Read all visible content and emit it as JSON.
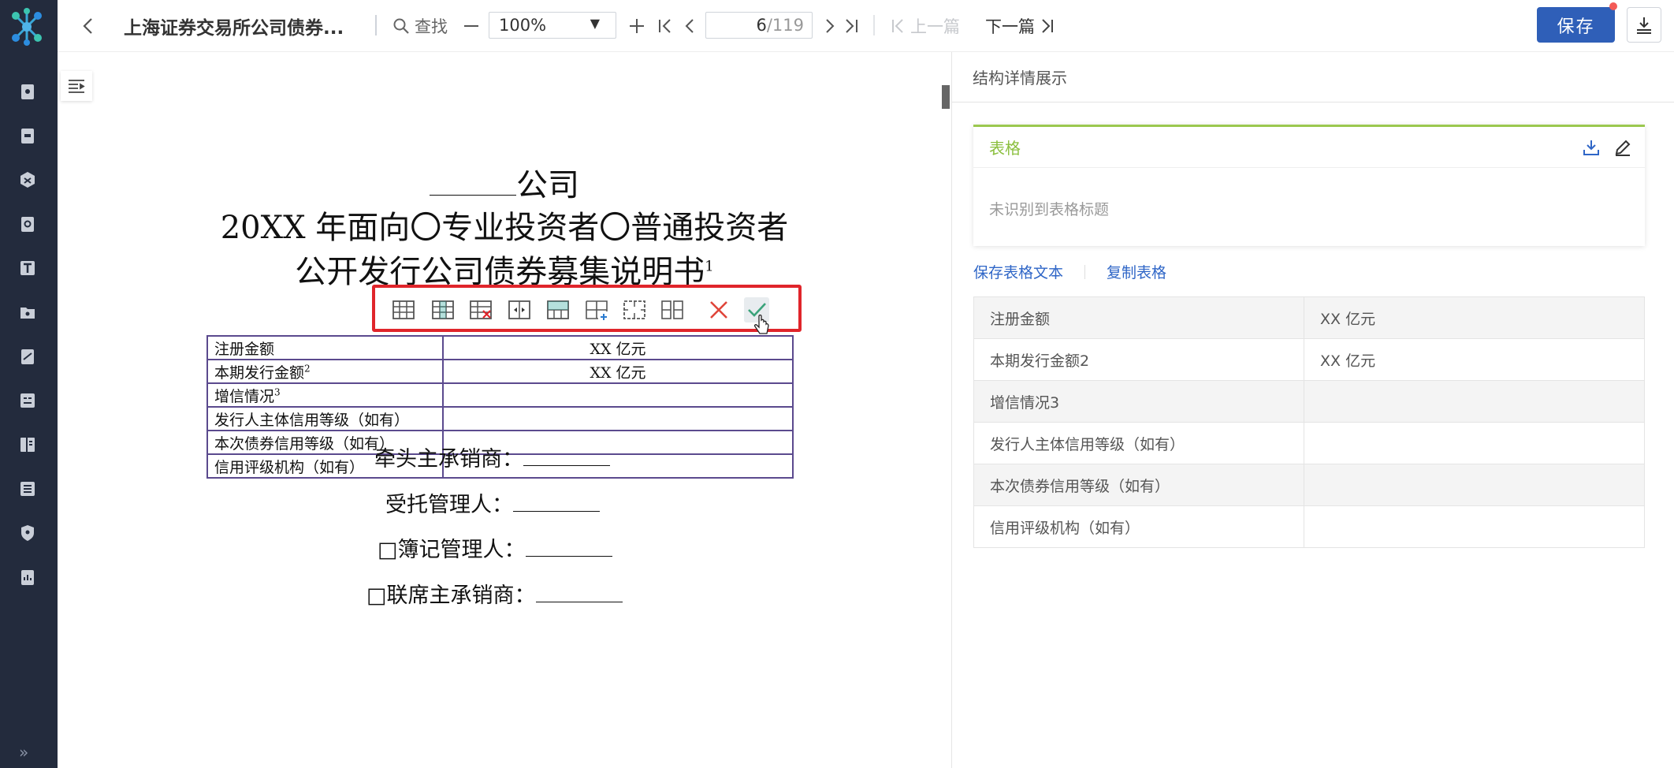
{
  "toolbar": {
    "doc_title": "上海证券交易所公司债券...",
    "find_label": "查找",
    "zoom_value": "100%",
    "page_current": "6",
    "page_total": "/119",
    "prev_doc": "上一篇",
    "next_doc": "下一篇",
    "save_label": "保存"
  },
  "document": {
    "company_suffix": "公司",
    "title_line2": "20XX 年面向〇专业投资者〇普通投资者",
    "title_line3": "公开发行公司债券募集说明书",
    "title_line3_sup": "1",
    "table_rows": [
      {
        "key": "注册金额",
        "sup": "",
        "value": "XX 亿元"
      },
      {
        "key": "本期发行金额",
        "sup": "2",
        "value": "XX 亿元"
      },
      {
        "key": "增信情况",
        "sup": "3",
        "value": ""
      },
      {
        "key": "发行人主体信用等级（如有）",
        "sup": "",
        "value": ""
      },
      {
        "key": "本次债券信用等级（如有）",
        "sup": "",
        "value": ""
      },
      {
        "key": "信用评级机构（如有）",
        "sup": "",
        "value": ""
      }
    ],
    "sig_lead_underwriter": "牵头主承销商：",
    "sig_trustee": "受托管理人：",
    "sig_bookrunner": "□簿记管理人：",
    "sig_joint_underwriter": "□联席主承销商："
  },
  "table_toolbar": {
    "icons": [
      "insert-row-icon",
      "insert-column-icon",
      "delete-column-icon",
      "split-column-icon",
      "merge-row-icon",
      "add-cell-icon",
      "merge-cells-icon",
      "split-cells-icon",
      "cancel-icon",
      "confirm-icon"
    ]
  },
  "panel": {
    "title": "结构详情展示",
    "card_title": "表格",
    "card_placeholder": "未识别到表格标题",
    "save_table_text": "保存表格文本",
    "copy_table": "复制表格",
    "rows": [
      {
        "key": "注册金额",
        "value": "XX 亿元"
      },
      {
        "key": "本期发行金额2",
        "value": "XX 亿元"
      },
      {
        "key": "增信情况3",
        "value": ""
      },
      {
        "key": "发行人主体信用等级（如有）",
        "value": ""
      },
      {
        "key": "本次债券信用等级（如有）",
        "value": ""
      },
      {
        "key": "信用评级机构（如有）",
        "value": ""
      }
    ]
  },
  "colors": {
    "rail_bg": "#232b3d",
    "primary_blue": "#2f5fb8",
    "highlight_red": "#e0252b",
    "card_accent": "#9bc84f",
    "table_border": "#5b4a8e"
  }
}
